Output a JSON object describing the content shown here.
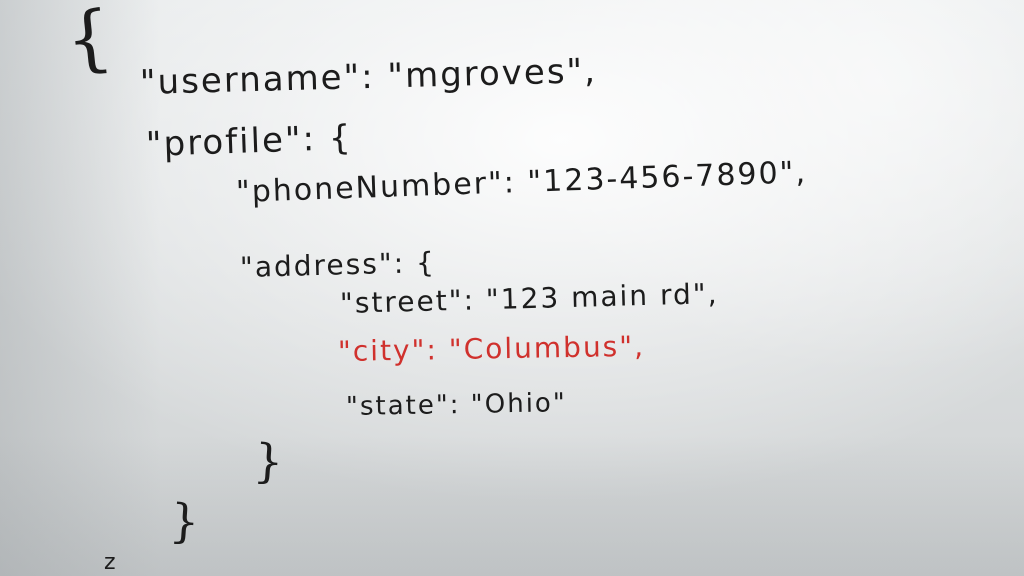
{
  "whiteboard": {
    "lines": {
      "open_brace": "{",
      "username": "\"username\": \"mgroves\",",
      "profile": "\"profile\": {",
      "phone": "\"phoneNumber\": \"123-456-7890\",",
      "address": "\"address\": {",
      "street": "\"street\": \"123 main rd\",",
      "city": "\"city\": \"Columbus\",",
      "state": "\"state\": \"Ohio\"",
      "close_address": "}",
      "close_profile": "}",
      "trailing_mark": "z"
    },
    "colors": {
      "ink_black": "#1c1c1c",
      "ink_red": "#d0312d",
      "board": "#e3e6e7"
    }
  }
}
